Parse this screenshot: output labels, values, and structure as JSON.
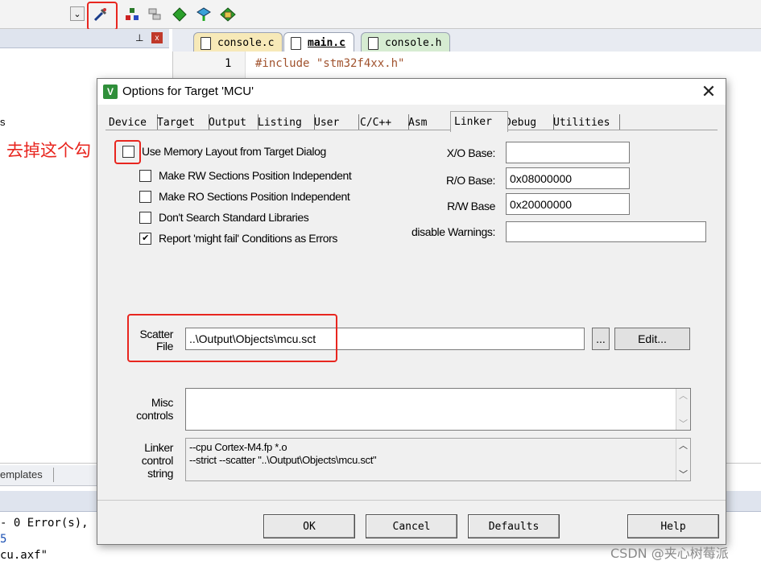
{
  "ide": {
    "tabs": [
      "console.c",
      "main.c",
      "console.h"
    ],
    "line_number": "1",
    "code_line": "#include \"stm32f4xx.h\"",
    "left_fragment": "s",
    "bottom_tab_fragment": "emplates",
    "build_lines": [
      "- 0 Error(s),",
      "5",
      "cu.axf\""
    ]
  },
  "annotation": {
    "text": "去掉这个勾",
    "color": "#e8261f"
  },
  "dialog": {
    "title": "Options for Target 'MCU'",
    "close_glyph": "✕",
    "tabs": [
      "Device",
      "Target",
      "Output",
      "Listing",
      "User",
      "C/C++",
      "Asm",
      "Linker",
      "Debug",
      "Utilities"
    ],
    "active_tab": "Linker",
    "checkboxes": [
      {
        "label": "Use Memory Layout from Target Dialog",
        "checked": false
      },
      {
        "label": "Make RW Sections Position Independent",
        "checked": false
      },
      {
        "label": "Make RO Sections Position Independent",
        "checked": false
      },
      {
        "label": "Don't Search Standard Libraries",
        "checked": false
      },
      {
        "label": "Report 'might fail' Conditions as Errors",
        "checked": true
      }
    ],
    "check_glyph": "✔",
    "fields": {
      "xo_label": "X/O Base:",
      "xo_value": "",
      "ro_label": "R/O Base:",
      "ro_value": "0x08000000",
      "rw_label": "R/W Base",
      "rw_value": "0x20000000",
      "warn_label": "disable Warnings:",
      "warn_value": ""
    },
    "scatter": {
      "label_line1": "Scatter",
      "label_line2": "File",
      "value": "..\\Output\\Objects\\mcu.sct",
      "browse": "...",
      "edit": "Edit..."
    },
    "misc": {
      "label_line1": "Misc",
      "label_line2": "controls",
      "value": ""
    },
    "linker": {
      "label_line1": "Linker",
      "label_line2": "control",
      "label_line3": "string",
      "line1": "--cpu Cortex-M4.fp *.o",
      "line2": "--strict --scatter \"..\\Output\\Objects\\mcu.sct\""
    },
    "buttons": {
      "ok": "OK",
      "cancel": "Cancel",
      "defaults": "Defaults",
      "help": "Help"
    }
  },
  "watermark": "CSDN @夹心树莓派"
}
